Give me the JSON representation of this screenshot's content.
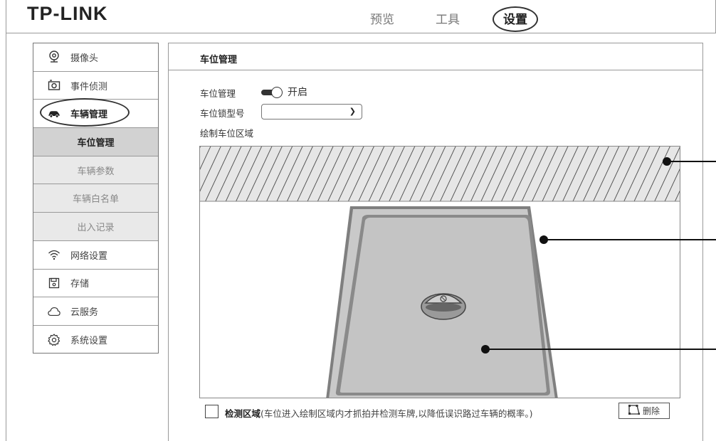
{
  "header": {
    "logo": "TP-LINK",
    "nav": [
      {
        "label": "预览"
      },
      {
        "label": "工具"
      },
      {
        "label": "设置"
      }
    ]
  },
  "sidebar": {
    "items": [
      {
        "label": "摄像头",
        "icon": "camera-icon"
      },
      {
        "label": "事件侦测",
        "icon": "event-detection-icon"
      },
      {
        "label": "车辆管理",
        "icon": "car-icon"
      },
      {
        "label": "车位管理"
      },
      {
        "label": "车辆参数"
      },
      {
        "label": "车辆白名单"
      },
      {
        "label": "出入记录"
      },
      {
        "label": "网络设置",
        "icon": "wifi-icon"
      },
      {
        "label": "存储",
        "icon": "storage-icon"
      },
      {
        "label": "云服务",
        "icon": "cloud-icon"
      },
      {
        "label": "系统设置",
        "icon": "gear-icon"
      }
    ]
  },
  "main": {
    "title": "车位管理",
    "toggle_label": "车位管理",
    "toggle_state": "开启",
    "lock_type_label": "车位锁型号",
    "lock_type_value": "",
    "draw_label": "绘制车位区域",
    "detect_label": "检测区域",
    "detect_hint": "(车位进入绘制区域内才抓拍并检测车牌,以降低误识路过车辆的概率。)",
    "delete_label": "删除"
  }
}
